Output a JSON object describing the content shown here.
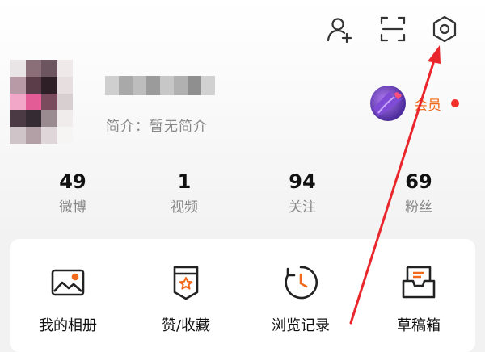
{
  "profile": {
    "bio": "简介：暂无简介",
    "vip_label": "会员"
  },
  "header": {
    "icons": [
      "add-friend-icon",
      "scan-icon",
      "settings-icon"
    ]
  },
  "stats": [
    {
      "value": "49",
      "label": "微博"
    },
    {
      "value": "1",
      "label": "视频"
    },
    {
      "value": "94",
      "label": "关注"
    },
    {
      "value": "69",
      "label": "粉丝"
    }
  ],
  "tools": [
    {
      "label": "我的相册",
      "icon": "photo-album-icon"
    },
    {
      "label": "赞/收藏",
      "icon": "favorites-icon"
    },
    {
      "label": "浏览记录",
      "icon": "history-icon"
    },
    {
      "label": "草稿箱",
      "icon": "drafts-icon"
    }
  ],
  "colors": {
    "accent": "#f26a1b",
    "annotation_arrow": "#e8262b",
    "notification_dot": "#f0312e"
  }
}
